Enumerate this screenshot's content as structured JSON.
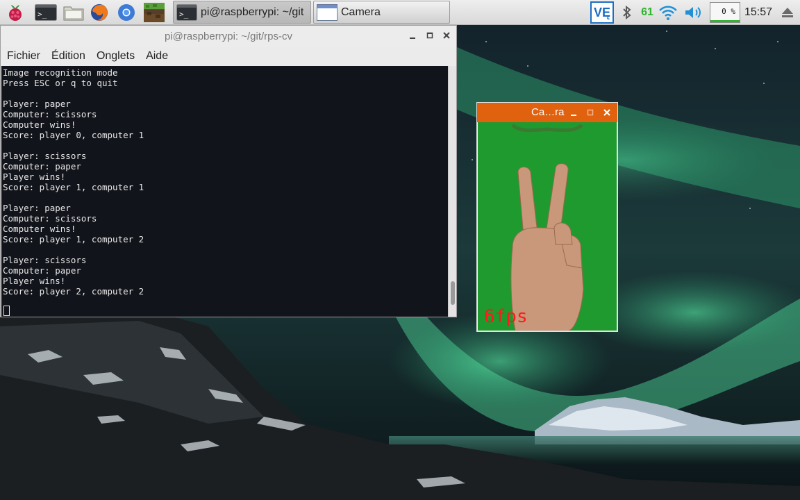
{
  "taskbar": {
    "launchers": [
      {
        "name": "raspberry-menu",
        "icon": "raspberry-icon"
      },
      {
        "name": "terminal-launcher",
        "icon": "terminal-icon"
      },
      {
        "name": "file-manager-launcher",
        "icon": "folder-icon"
      },
      {
        "name": "firefox-launcher",
        "icon": "firefox-icon"
      },
      {
        "name": "chromium-launcher",
        "icon": "chromium-icon"
      },
      {
        "name": "minecraft-launcher",
        "icon": "minecraft-icon"
      }
    ],
    "tasks": [
      {
        "label": "pi@raspberrypi: ~/git",
        "icon": "terminal-icon",
        "active": true
      },
      {
        "label": "Camera",
        "icon": "window-icon",
        "active": false
      }
    ],
    "tray": {
      "vnc_label": "VĘ",
      "cpu_temp": "61",
      "cpu_usage": "0 %",
      "clock": "15:57"
    }
  },
  "terminal": {
    "title": "pi@raspberrypi: ~/git/rps-cv",
    "menu": [
      "Fichier",
      "Édition",
      "Onglets",
      "Aide"
    ],
    "lines": [
      "Image recognition mode",
      "Press ESC or q to quit",
      "",
      "Player: paper",
      "Computer: scissors",
      "Computer wins!",
      "Score: player 0, computer 1",
      "",
      "Player: scissors",
      "Computer: paper",
      "Player wins!",
      "Score: player 1, computer 1",
      "",
      "Player: paper",
      "Computer: scissors",
      "Computer wins!",
      "Score: player 1, computer 2",
      "",
      "Player: scissors",
      "Computer: paper",
      "Player wins!",
      "Score: player 2, computer 2"
    ]
  },
  "camera": {
    "title": "Ca…ra",
    "fps_label": "6fps"
  },
  "colors": {
    "camera_titlebar": "#e0620f",
    "camera_background": "#1f9a2e",
    "fps_text": "#ff1a1a",
    "temp_text": "#2fb52f"
  }
}
